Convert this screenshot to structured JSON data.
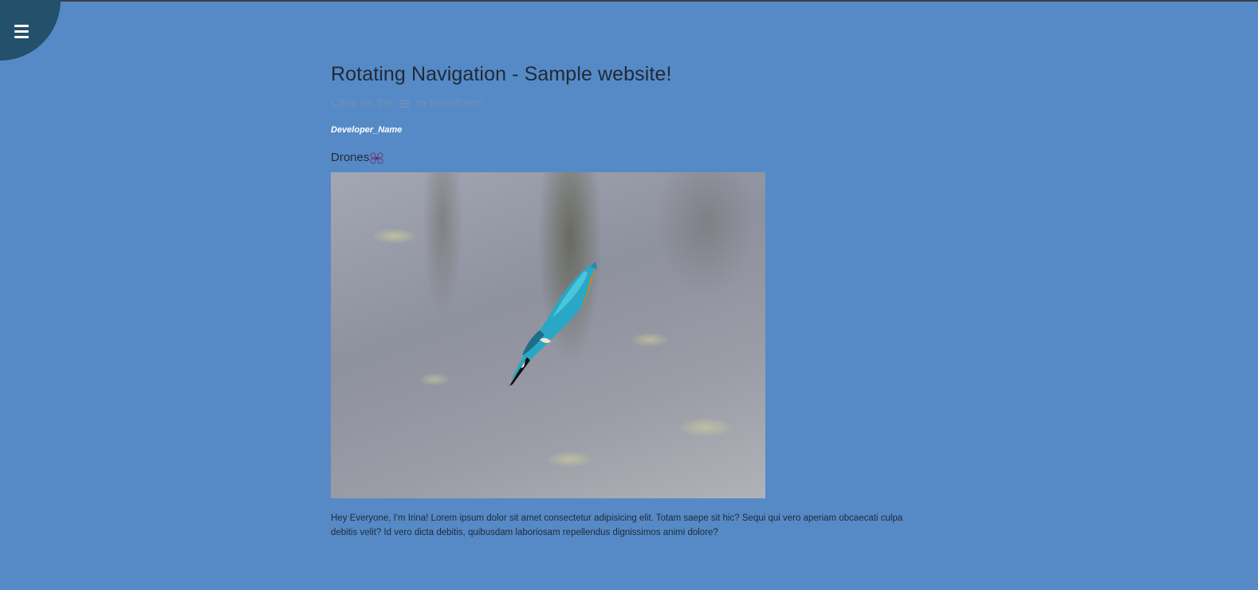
{
  "nav": {
    "menu_icon": "hamburger-icon",
    "background_color": "#23506a"
  },
  "header": {
    "title": "Rotating Navigation - Sample website!",
    "subtitle_before": "Click on the",
    "subtitle_icon": "hamburger-icon",
    "subtitle_after": "to transform!",
    "developer": "Developer_Name"
  },
  "content": {
    "section_label": "Drones",
    "section_icon": "drone-icon",
    "image_subject": "kingfisher-diving-photo",
    "paragraph": "Hey Everyone, I'm Irina! Lorem ipsum dolor sit amet consectetur adipisicing elit. Totam saepe sit hic? Sequi qui vero aperiam obcaecati culpa debitis velit? Id vero dicta debitis, quibusdam laboriosam repellendus dignissimos animi dolore?"
  },
  "colors": {
    "page_background": "#568ac6",
    "text": "#1f2a38",
    "muted_text": "#6e8fb8"
  }
}
